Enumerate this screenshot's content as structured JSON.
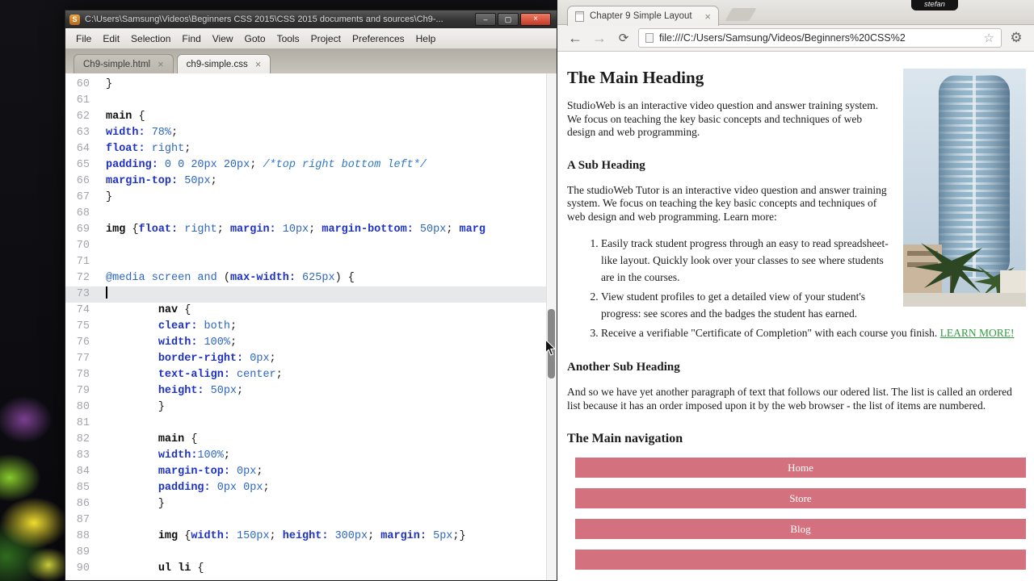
{
  "colors": {
    "nav_button": "#d4717e",
    "link_green": "#2f9e3f",
    "code_property_blue": "#1d31c8",
    "code_value_blue": "#2d66c3",
    "close_button_red": "#c23b27"
  },
  "icons": {
    "minimize": "–",
    "maximize": "▢",
    "close": "×",
    "back": "←",
    "forward": "→",
    "refresh": "⟳",
    "star": "☆",
    "gear": "⚙",
    "app_logo": "S"
  },
  "editor": {
    "title": "C:\\Users\\Samsung\\Videos\\Beginners CSS 2015\\CSS 2015 documents and sources\\Ch9-...",
    "menus": [
      "File",
      "Edit",
      "Selection",
      "Find",
      "View",
      "Goto",
      "Tools",
      "Project",
      "Preferences",
      "Help"
    ],
    "tabs": [
      {
        "label": "Ch9-simple.html",
        "active": false
      },
      {
        "label": "ch9-simple.css",
        "active": true
      }
    ],
    "code_lines": [
      {
        "n": 60,
        "t": [
          [
            "pl",
            "}"
          ]
        ]
      },
      {
        "n": 61,
        "t": []
      },
      {
        "n": 62,
        "t": [
          [
            "sel",
            "main"
          ],
          [
            "pl",
            " {"
          ]
        ]
      },
      {
        "n": 63,
        "t": [
          [
            "pr",
            "width:"
          ],
          [
            "va",
            " 78%"
          ],
          [
            "pl",
            ";"
          ]
        ]
      },
      {
        "n": 64,
        "t": [
          [
            "pr",
            "float:"
          ],
          [
            "va",
            " right"
          ],
          [
            "pl",
            ";"
          ]
        ]
      },
      {
        "n": 65,
        "t": [
          [
            "pr",
            "padding:"
          ],
          [
            "va",
            " 0 0 20px 20px"
          ],
          [
            "pl",
            "; "
          ],
          [
            "co",
            "/*top right bottom left*/"
          ]
        ]
      },
      {
        "n": 66,
        "t": [
          [
            "pr",
            "margin-top:"
          ],
          [
            "va",
            " 50px"
          ],
          [
            "pl",
            ";"
          ]
        ]
      },
      {
        "n": 67,
        "t": [
          [
            "pl",
            "}"
          ]
        ]
      },
      {
        "n": 68,
        "t": []
      },
      {
        "n": 69,
        "t": [
          [
            "sel",
            "img"
          ],
          [
            "pl",
            " {"
          ],
          [
            "pr",
            "float:"
          ],
          [
            "va",
            " right"
          ],
          [
            "pl",
            "; "
          ],
          [
            "pr",
            "margin:"
          ],
          [
            "va",
            " 10px"
          ],
          [
            "pl",
            "; "
          ],
          [
            "pr",
            "margin-bottom:"
          ],
          [
            "va",
            " 50px"
          ],
          [
            "pl",
            "; "
          ],
          [
            "pr",
            "marg"
          ]
        ]
      },
      {
        "n": 70,
        "t": []
      },
      {
        "n": 71,
        "t": []
      },
      {
        "n": 72,
        "t": [
          [
            "at",
            "@media screen and"
          ],
          [
            "pl",
            " ("
          ],
          [
            "pr",
            "max-width:"
          ],
          [
            "va",
            " 625px"
          ],
          [
            "pl",
            ") {"
          ]
        ]
      },
      {
        "n": 73,
        "t": [],
        "hl": true,
        "cur": true
      },
      {
        "n": 74,
        "t": [
          [
            "pl",
            "        "
          ],
          [
            "sel",
            "nav"
          ],
          [
            "pl",
            " {"
          ]
        ]
      },
      {
        "n": 75,
        "t": [
          [
            "pl",
            "        "
          ],
          [
            "pr",
            "clear:"
          ],
          [
            "va",
            " both"
          ],
          [
            "pl",
            ";"
          ]
        ]
      },
      {
        "n": 76,
        "t": [
          [
            "pl",
            "        "
          ],
          [
            "pr",
            "width:"
          ],
          [
            "va",
            " 100%"
          ],
          [
            "pl",
            ";"
          ]
        ]
      },
      {
        "n": 77,
        "t": [
          [
            "pl",
            "        "
          ],
          [
            "pr",
            "border-right:"
          ],
          [
            "va",
            " 0px"
          ],
          [
            "pl",
            ";"
          ]
        ]
      },
      {
        "n": 78,
        "t": [
          [
            "pl",
            "        "
          ],
          [
            "pr",
            "text-align:"
          ],
          [
            "va",
            " center"
          ],
          [
            "pl",
            ";"
          ]
        ]
      },
      {
        "n": 79,
        "t": [
          [
            "pl",
            "        "
          ],
          [
            "pr",
            "height:"
          ],
          [
            "va",
            " 50px"
          ],
          [
            "pl",
            ";"
          ]
        ]
      },
      {
        "n": 80,
        "t": [
          [
            "pl",
            "        }"
          ]
        ]
      },
      {
        "n": 81,
        "t": []
      },
      {
        "n": 82,
        "t": [
          [
            "pl",
            "        "
          ],
          [
            "sel",
            "main"
          ],
          [
            "pl",
            " {"
          ]
        ]
      },
      {
        "n": 83,
        "t": [
          [
            "pl",
            "        "
          ],
          [
            "pr",
            "width:"
          ],
          [
            "va",
            "100%"
          ],
          [
            "pl",
            ";"
          ]
        ]
      },
      {
        "n": 84,
        "t": [
          [
            "pl",
            "        "
          ],
          [
            "pr",
            "margin-top:"
          ],
          [
            "va",
            " 0px"
          ],
          [
            "pl",
            ";"
          ]
        ]
      },
      {
        "n": 85,
        "t": [
          [
            "pl",
            "        "
          ],
          [
            "pr",
            "padding:"
          ],
          [
            "va",
            " 0px 0px"
          ],
          [
            "pl",
            ";"
          ]
        ]
      },
      {
        "n": 86,
        "t": [
          [
            "pl",
            "        }"
          ]
        ]
      },
      {
        "n": 87,
        "t": []
      },
      {
        "n": 88,
        "t": [
          [
            "pl",
            "        "
          ],
          [
            "sel",
            "img"
          ],
          [
            "pl",
            " {"
          ],
          [
            "pr",
            "width:"
          ],
          [
            "va",
            " 150px"
          ],
          [
            "pl",
            "; "
          ],
          [
            "pr",
            "height:"
          ],
          [
            "va",
            " 300px"
          ],
          [
            "pl",
            "; "
          ],
          [
            "pr",
            "margin:"
          ],
          [
            "va",
            " 5px"
          ],
          [
            "pl",
            ";}"
          ]
        ]
      },
      {
        "n": 89,
        "t": []
      },
      {
        "n": 90,
        "t": [
          [
            "pl",
            "        "
          ],
          [
            "sel",
            "ul li"
          ],
          [
            "pl",
            " {"
          ]
        ]
      }
    ]
  },
  "browser": {
    "tab_title": "Chapter 9 Simple Layout",
    "url": "file:///C:/Users/Samsung/Videos/Beginners%20CSS%2",
    "overlay_badge": "stefan",
    "page": {
      "h1": "The Main Heading",
      "p1": "StudioWeb is an interactive video question and answer training system. We focus on teaching the key basic concepts and techniques of web design and web programming.",
      "h2a": "A Sub Heading",
      "p2": "The studioWeb Tutor is an interactive video question and answer training system. We focus on teaching the key basic concepts and techniques of web design and web programming. Learn more:",
      "list": [
        "Easily track student progress through an easy to read spreadsheet-like layout. Quickly look over your classes to see where students are in the courses.",
        "View student profiles to get a detailed view of your student's progress: see scores and the badges the student has earned.",
        "Receive a verifiable \"Certificate of Completion\" with each course you finish."
      ],
      "link_label": "LEARN MORE!",
      "h2b": "Another Sub Heading",
      "p3": "And so we have yet another paragraph of text that follows our odered list. The list is called an ordered list because it has an order imposed upon it by the web browser - the list of items are numbered.",
      "h2c": "The Main navigation",
      "nav": [
        "Home",
        "Store",
        "Blog"
      ]
    }
  }
}
